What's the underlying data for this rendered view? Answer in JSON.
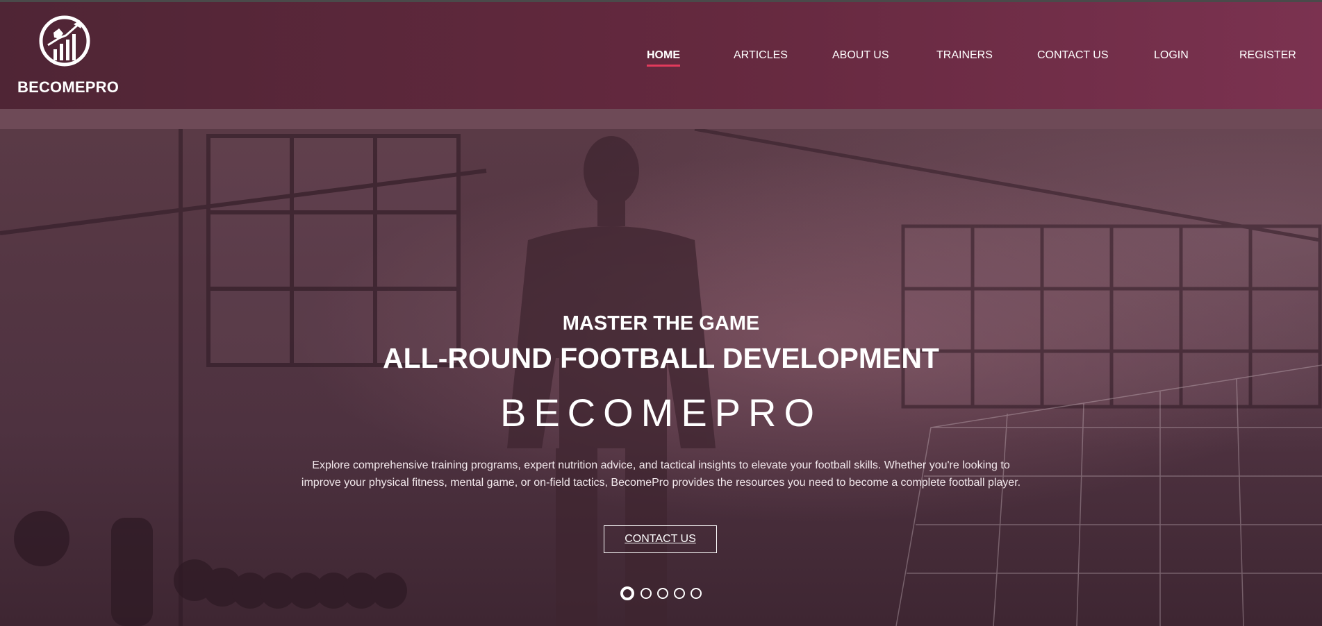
{
  "brand": {
    "name": "BECOMEPRO",
    "logo_icon": "football-growth-chart-icon"
  },
  "nav": {
    "items": [
      {
        "label": "HOME",
        "active": true
      },
      {
        "label": "ARTICLES",
        "active": false
      },
      {
        "label": "ABOUT US",
        "active": false
      },
      {
        "label": "TRAINERS",
        "active": false
      },
      {
        "label": "CONTACT US",
        "active": false
      },
      {
        "label": "LOGIN",
        "active": false
      },
      {
        "label": "REGISTER",
        "active": false
      }
    ]
  },
  "hero": {
    "subtitle": "MASTER THE GAME",
    "title": "ALL-ROUND FOOTBALL DEVELOPMENT",
    "brand": "BECOMEPRO",
    "description": "Explore comprehensive training programs, expert nutrition advice, and tactical insights to elevate your football skills. Whether you're looking to improve your physical fitness, mental game, or on-field tactics, BecomePro provides the resources you need to become a complete football player.",
    "cta_label": "CONTACT US",
    "slides_count": 5,
    "active_slide": 1
  },
  "colors": {
    "header_start": "#4f2535",
    "header_end": "#7b3250",
    "accent": "#e23a5c",
    "hero_overlay": "#4e3240"
  }
}
